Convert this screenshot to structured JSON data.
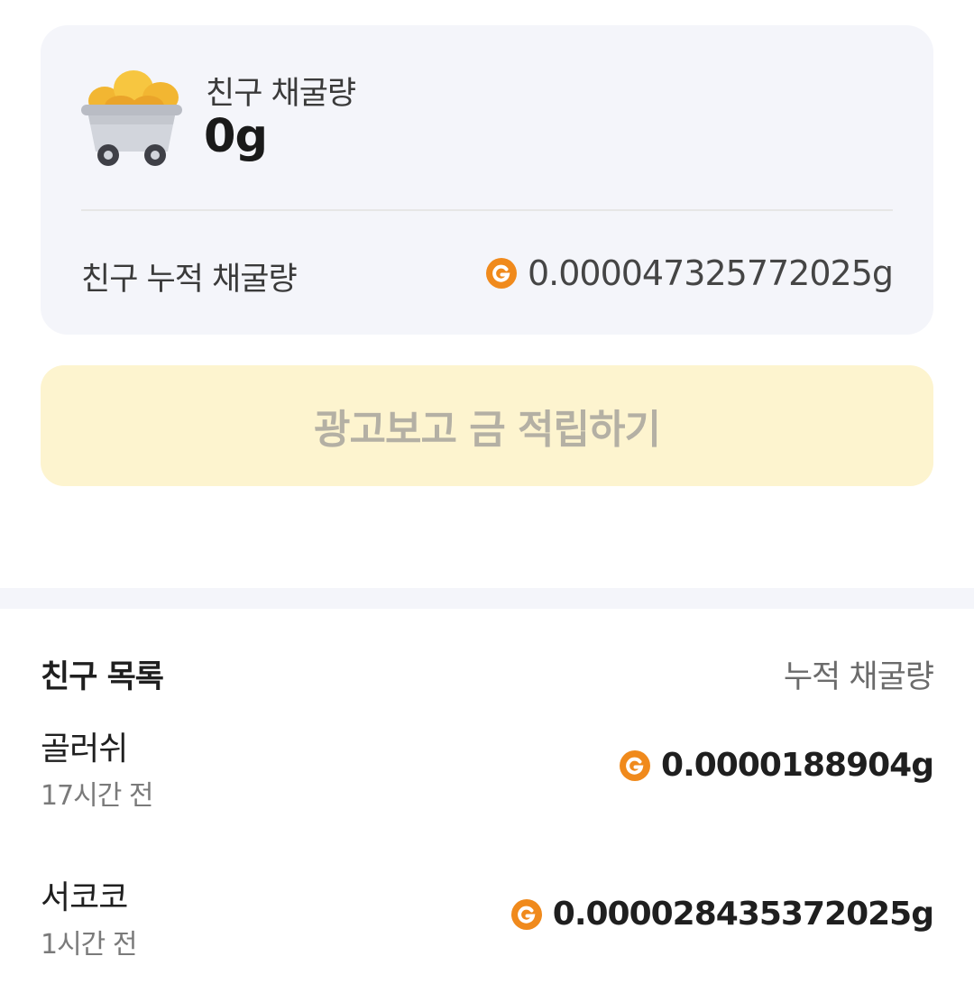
{
  "summary": {
    "today_label": "친구 채굴량",
    "today_value": "0g",
    "total_label": "친구 누적 채굴량",
    "total_value": "0.000047325772025g"
  },
  "ad_button": {
    "label": "광고보고 금 적립하기"
  },
  "friends": {
    "title": "친구 목록",
    "column_header": "누적 채굴량",
    "items": [
      {
        "name": "골러쉬",
        "time": "17시간 전",
        "amount": "0.0000188904g"
      },
      {
        "name": "서코코",
        "time": "1시간 전",
        "amount": "0.000028435372025g"
      }
    ]
  },
  "icons": {
    "cart": "mine-cart-gold-icon",
    "gold": "gold-coin-g-icon"
  },
  "colors": {
    "accent_orange": "#f08a1c",
    "card_bg": "#f4f5fa",
    "ad_button_bg": "#fdf4cf",
    "ad_button_text": "#b4b0a4",
    "gold_nugget": "#f2b632"
  }
}
